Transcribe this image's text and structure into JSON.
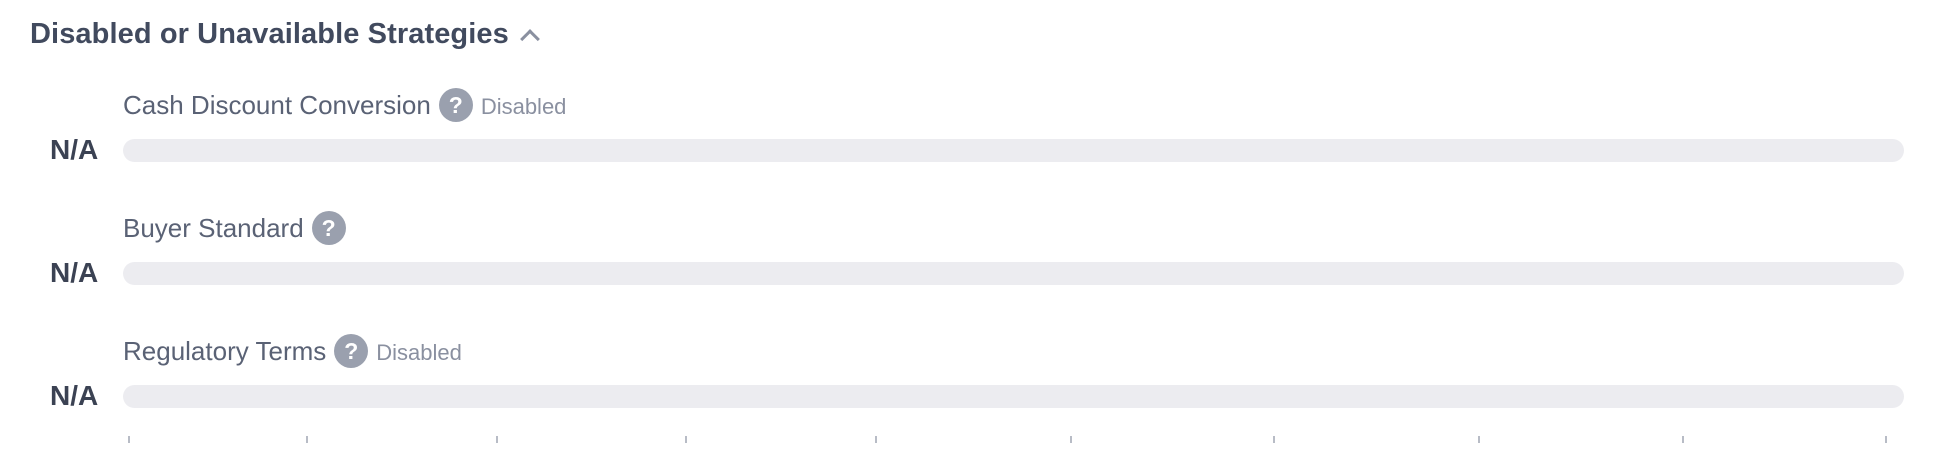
{
  "section": {
    "title": "Disabled or Unavailable Strategies",
    "chevron_icon": "chevron-up-icon"
  },
  "strategies": [
    {
      "name": "Cash Discount Conversion",
      "status": "Disabled",
      "value": "N/A",
      "help_icon": "question-icon"
    },
    {
      "name": "Buyer Standard",
      "status": "",
      "value": "N/A",
      "help_icon": "question-icon"
    },
    {
      "name": "Regulatory Terms",
      "status": "Disabled",
      "value": "N/A",
      "help_icon": "question-icon"
    }
  ],
  "help_glyph": "?",
  "colors": {
    "track": "#ececf0",
    "help_icon_bg": "#9aa0ae",
    "title": "#414a5e"
  }
}
